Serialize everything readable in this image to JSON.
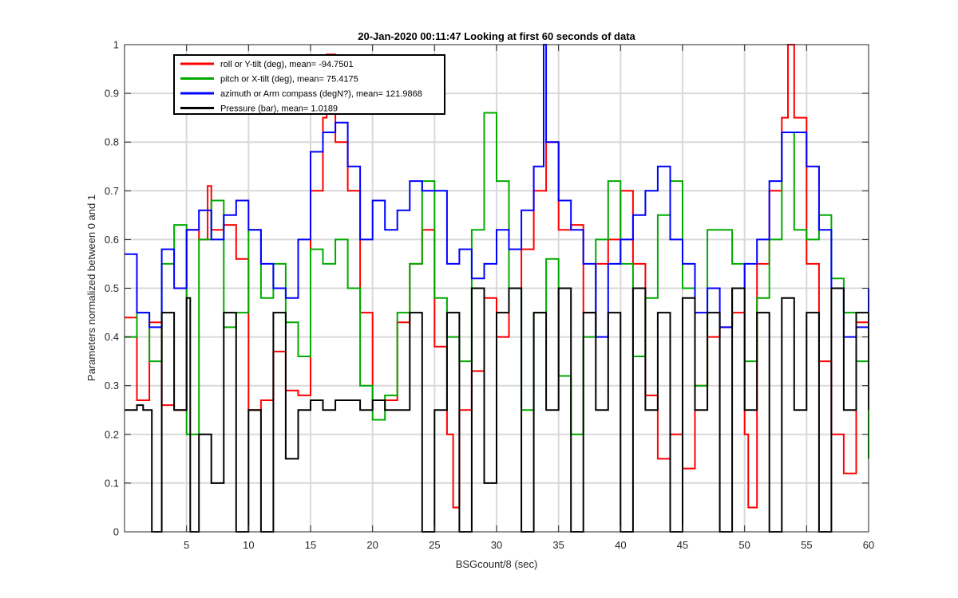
{
  "chart_data": {
    "type": "line",
    "title": "20-Jan-2020 00:11:47 Looking at first 60 seconds of data",
    "xlabel": "BSGcount/8 (sec)",
    "ylabel": "Parameters normalized between 0 and 1",
    "xlim": [
      0,
      60
    ],
    "ylim": [
      0,
      1
    ],
    "xticks": [
      5,
      10,
      15,
      20,
      25,
      30,
      35,
      40,
      45,
      50,
      55,
      60
    ],
    "xtick_labels": [
      "5",
      "10",
      "15",
      "20",
      "25",
      "30",
      "35",
      "40",
      "45",
      "50",
      "55",
      "60"
    ],
    "yticks": [
      0,
      0.1,
      0.2,
      0.3,
      0.4,
      0.5,
      0.6,
      0.7,
      0.8,
      0.9,
      1
    ],
    "ytick_labels": [
      "0",
      "0.1",
      "0.2",
      "0.3",
      "0.4",
      "0.5",
      "0.6",
      "0.7",
      "0.8",
      "0.9",
      "1"
    ],
    "grid": true,
    "legend_position": "top-left",
    "series": [
      {
        "name": "roll or Y-tilt (deg), mean= -94.7501",
        "color": "#ff0000",
        "x": [
          0,
          1,
          2,
          3,
          4,
          5,
          6,
          6.7,
          7,
          8,
          9,
          10,
          11,
          12,
          13,
          14,
          15,
          16,
          16.3,
          17,
          18,
          19,
          20,
          21,
          22,
          23,
          24,
          25,
          26,
          26.5,
          27,
          28,
          29,
          30,
          31,
          32,
          33,
          34,
          35,
          36,
          37,
          38,
          39,
          40,
          41,
          42,
          43,
          44,
          45,
          46,
          47,
          48,
          49,
          50,
          50.3,
          51,
          52,
          53,
          53.5,
          54,
          55,
          56,
          57,
          58,
          59,
          60
        ],
        "y": [
          0.44,
          0.27,
          0.43,
          0.26,
          0.25,
          0.62,
          0.6,
          0.71,
          0.62,
          0.63,
          0.56,
          0.25,
          0.27,
          0.37,
          0.29,
          0.28,
          0.7,
          0.85,
          0.98,
          0.8,
          0.7,
          0.45,
          0.27,
          0.27,
          0.43,
          0.55,
          0.62,
          0.38,
          0.2,
          0.05,
          0.25,
          0.33,
          0.48,
          0.4,
          0.5,
          0.58,
          0.7,
          0.8,
          0.62,
          0.63,
          0.45,
          0.55,
          0.6,
          0.7,
          0.55,
          0.28,
          0.15,
          0.2,
          0.13,
          0.3,
          0.4,
          0.42,
          0.45,
          0.2,
          0.05,
          0.55,
          0.7,
          0.85,
          1.0,
          0.85,
          0.55,
          0.35,
          0.2,
          0.12,
          0.43,
          0.4
        ]
      },
      {
        "name": "pitch or X-tilt (deg), mean= 75.4175",
        "color": "#00aa00",
        "x": [
          0,
          1,
          2,
          3,
          4,
          5,
          6,
          7,
          8,
          9,
          10,
          11,
          12,
          13,
          14,
          15,
          16,
          17,
          18,
          19,
          20,
          21,
          22,
          23,
          24,
          25,
          26,
          27,
          28,
          29,
          30,
          31,
          32,
          33,
          34,
          35,
          36,
          37,
          38,
          39,
          40,
          41,
          42,
          43,
          44,
          45,
          46,
          47,
          48,
          49,
          50,
          51,
          52,
          53,
          54,
          55,
          56,
          57,
          58,
          59,
          60
        ],
        "y": [
          0.4,
          0.45,
          0.35,
          0.55,
          0.63,
          0.2,
          0.6,
          0.68,
          0.42,
          0.45,
          0.62,
          0.48,
          0.55,
          0.43,
          0.36,
          0.58,
          0.55,
          0.6,
          0.5,
          0.3,
          0.23,
          0.28,
          0.45,
          0.55,
          0.72,
          0.48,
          0.4,
          0.35,
          0.62,
          0.86,
          0.72,
          0.5,
          0.25,
          0.45,
          0.56,
          0.32,
          0.2,
          0.4,
          0.6,
          0.72,
          0.55,
          0.36,
          0.48,
          0.65,
          0.72,
          0.5,
          0.3,
          0.62,
          0.62,
          0.55,
          0.35,
          0.48,
          0.6,
          0.82,
          0.62,
          0.6,
          0.65,
          0.52,
          0.45,
          0.35,
          0.15
        ]
      },
      {
        "name": "azimuth or Arm compass (degN?), mean= 121.9868",
        "color": "#0000ff",
        "x": [
          0,
          1,
          2,
          3,
          4,
          5,
          6,
          7,
          8,
          9,
          10,
          11,
          12,
          13,
          14,
          15,
          16,
          17,
          18,
          19,
          20,
          21,
          22,
          23,
          24,
          25,
          26,
          27,
          28,
          29,
          30,
          31,
          32,
          33,
          33.8,
          34,
          35,
          36,
          37,
          38,
          39,
          40,
          41,
          42,
          43,
          44,
          45,
          46,
          47,
          48,
          49,
          50,
          51,
          52,
          53,
          54,
          55,
          56,
          57,
          58,
          59,
          60
        ],
        "y": [
          0.57,
          0.45,
          0.42,
          0.58,
          0.5,
          0.62,
          0.66,
          0.6,
          0.65,
          0.68,
          0.62,
          0.55,
          0.5,
          0.48,
          0.6,
          0.78,
          0.82,
          0.84,
          0.75,
          0.6,
          0.68,
          0.62,
          0.66,
          0.72,
          0.7,
          0.7,
          0.55,
          0.58,
          0.52,
          0.55,
          0.62,
          0.58,
          0.66,
          0.75,
          1.0,
          0.8,
          0.68,
          0.62,
          0.55,
          0.4,
          0.55,
          0.6,
          0.65,
          0.7,
          0.75,
          0.6,
          0.55,
          0.45,
          0.5,
          0.42,
          0.5,
          0.55,
          0.6,
          0.72,
          0.82,
          0.82,
          0.75,
          0.62,
          0.5,
          0.4,
          0.42,
          0.5
        ]
      },
      {
        "name": "Pressure (bar), mean= 1.0189",
        "color": "#000000",
        "x": [
          0,
          1,
          1.5,
          2,
          2.2,
          3,
          4,
          5,
          5.3,
          6,
          7,
          8,
          9,
          10,
          11,
          12,
          13,
          14,
          15,
          16,
          17,
          18,
          19,
          20,
          21,
          22,
          23,
          24,
          25,
          26,
          27,
          28,
          29,
          30,
          31,
          32,
          33,
          34,
          35,
          36,
          37,
          38,
          39,
          40,
          41,
          42,
          43,
          44,
          45,
          46,
          47,
          48,
          49,
          50,
          51,
          52,
          53,
          54,
          55,
          56,
          57,
          58,
          59,
          60
        ],
        "y": [
          0.25,
          0.26,
          0.25,
          0.25,
          0.0,
          0.45,
          0.25,
          0.48,
          0.0,
          0.2,
          0.1,
          0.45,
          0.0,
          0.25,
          0.0,
          0.45,
          0.15,
          0.25,
          0.27,
          0.25,
          0.27,
          0.27,
          0.25,
          0.27,
          0.25,
          0.25,
          0.45,
          0.0,
          0.25,
          0.45,
          0.0,
          0.5,
          0.1,
          0.45,
          0.5,
          0.0,
          0.45,
          0.25,
          0.5,
          0.0,
          0.45,
          0.25,
          0.45,
          0.0,
          0.5,
          0.25,
          0.45,
          0.0,
          0.48,
          0.25,
          0.45,
          0.0,
          0.5,
          0.25,
          0.45,
          0.0,
          0.48,
          0.25,
          0.45,
          0.0,
          0.5,
          0.25,
          0.45,
          0.25
        ]
      }
    ]
  }
}
